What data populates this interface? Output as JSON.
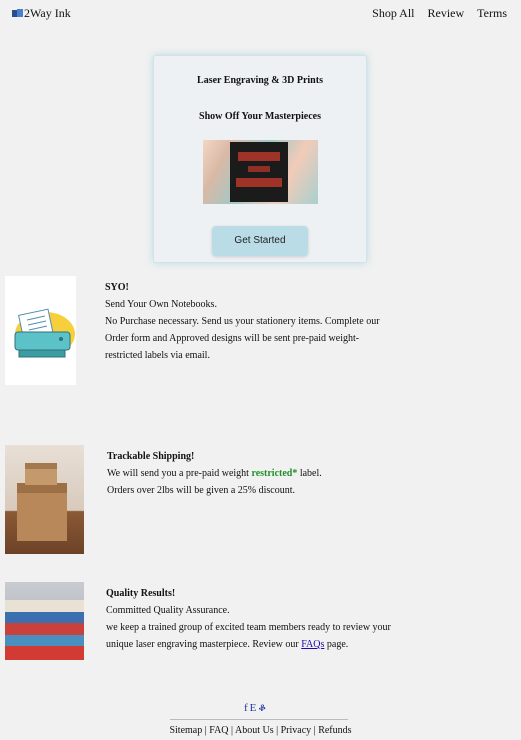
{
  "brand": "2Way Ink",
  "nav": [
    "Shop All",
    "Review",
    "Terms"
  ],
  "hero": {
    "title": "Laser Engraving & 3D Prints",
    "subtitle": "Show Off Your Masterpieces",
    "button": "Get Started"
  },
  "features": [
    {
      "title": "SYO!",
      "lines": [
        "Send Your Own Notebooks.",
        "No Purchase necessary. Send us your stationery items. Complete our",
        "Order form and Approved designs will be sent pre-paid weight-",
        "restricted labels via email."
      ]
    },
    {
      "title": "Trackable Shipping!",
      "line1_prefix": "We will send you a pre-paid weight",
      "line1_highlight": "restricted*",
      "line1_suffix": "label.",
      "line2": "Orders over 2lbs will be given a 25% discount."
    },
    {
      "title": "Quality Results!",
      "line1": "Committed Quality Assurance.",
      "line2": "we keep a trained group of excited team members ready to review your",
      "line3_prefix": "unique laser engraving masterpiece. Review our",
      "line3_link": "FAQs",
      "line3_suffix": "page."
    }
  ],
  "footer": {
    "icons": [
      "facebook-icon",
      "etsy-icon",
      "social-icon"
    ],
    "icon_glyphs": [
      "f",
      "E",
      "ቆ"
    ],
    "links": [
      "Sitemap",
      "FAQ",
      "About Us",
      "Privacy",
      "Refunds"
    ]
  },
  "colors": {
    "accent_green": "#1f8f2a",
    "button_bg": "#b9dce6",
    "link": "#1a0dab"
  }
}
